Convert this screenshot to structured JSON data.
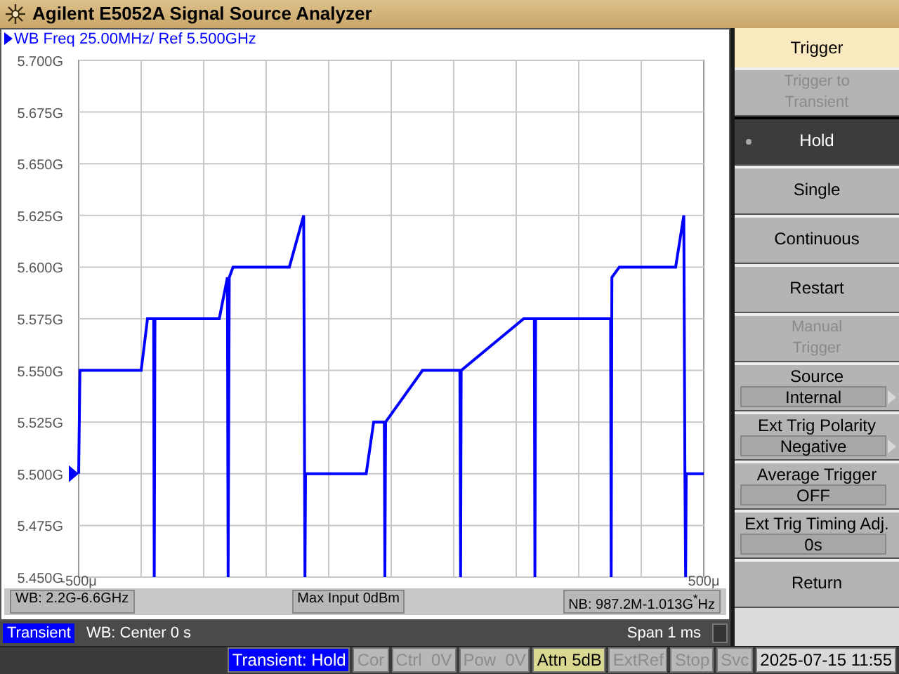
{
  "window": {
    "title": "Agilent E5052A Signal Source Analyzer"
  },
  "trace_title": "WB Freq 25.00MHz/ Ref 5.500GHz",
  "chart_data": {
    "type": "line",
    "grid": true,
    "xlim": [
      -500,
      500
    ],
    "ylim": [
      5.45,
      5.7
    ],
    "xticks": [
      {
        "value": -500,
        "label": "-500μ"
      },
      {
        "value": 500,
        "label": "500μ"
      }
    ],
    "yticks": [
      {
        "value": 5.7,
        "label": "5.700G"
      },
      {
        "value": 5.675,
        "label": "5.675G"
      },
      {
        "value": 5.65,
        "label": "5.650G"
      },
      {
        "value": 5.625,
        "label": "5.625G"
      },
      {
        "value": 5.6,
        "label": "5.600G"
      },
      {
        "value": 5.575,
        "label": "5.575G"
      },
      {
        "value": 5.55,
        "label": "5.550G"
      },
      {
        "value": 5.525,
        "label": "5.525G"
      },
      {
        "value": 5.5,
        "label": "5.500G"
      },
      {
        "value": 5.475,
        "label": "5.475G"
      },
      {
        "value": 5.45,
        "label": "5.450G"
      }
    ],
    "x": [
      -500,
      -498,
      -400,
      -390,
      -380,
      -379,
      -378,
      -275,
      -262,
      -261,
      -259,
      -253,
      -163,
      -140,
      -138,
      -137,
      -40,
      -28,
      -11,
      -10,
      -9,
      50,
      110,
      111,
      112,
      212,
      229,
      230,
      231,
      343,
      351,
      352,
      353,
      365,
      455,
      468,
      470,
      471,
      472,
      500
    ],
    "series": [
      {
        "color": "#0000ff",
        "values": [
          5.5,
          5.55,
          5.55,
          5.575,
          5.575,
          5.45,
          5.575,
          5.575,
          5.595,
          5.45,
          5.595,
          5.6,
          5.6,
          5.625,
          5.45,
          5.5,
          5.5,
          5.525,
          5.525,
          5.45,
          5.525,
          5.55,
          5.55,
          5.45,
          5.55,
          5.575,
          5.575,
          5.45,
          5.575,
          5.575,
          5.575,
          5.45,
          5.595,
          5.6,
          5.6,
          5.625,
          5.5,
          5.45,
          5.5,
          5.5
        ]
      }
    ]
  },
  "info_strip": [
    "WB: 2.2G-6.6GHz",
    "Max Input 0dBm",
    "NB: 987.2M-1.013G$^{*}$Hz"
  ],
  "channel_bar": {
    "mode": "Transient",
    "center": "WB: Center 0 s",
    "span": "Span 1 ms"
  },
  "softkey_menu": {
    "title": "Trigger",
    "keys": [
      {
        "kind": "button",
        "lines": [
          "Trigger to",
          "Transient"
        ],
        "disabled": true,
        "selected": false
      },
      {
        "kind": "button",
        "lines": [
          "Hold"
        ],
        "disabled": false,
        "selected": true
      },
      {
        "kind": "button",
        "lines": [
          "Single"
        ],
        "disabled": false,
        "selected": false
      },
      {
        "kind": "button",
        "lines": [
          "Continuous"
        ],
        "disabled": false,
        "selected": false
      },
      {
        "kind": "button",
        "lines": [
          "Restart"
        ],
        "disabled": false,
        "selected": false
      },
      {
        "kind": "button",
        "lines": [
          "Manual",
          "Trigger"
        ],
        "disabled": true,
        "selected": false
      },
      {
        "kind": "value",
        "lines": [
          "Source"
        ],
        "value": "Internal",
        "submenu": true,
        "disabled": false,
        "selected": false
      },
      {
        "kind": "value",
        "lines": [
          "Ext Trig Polarity"
        ],
        "value": "Negative",
        "submenu": true,
        "disabled": false,
        "selected": false
      },
      {
        "kind": "value",
        "lines": [
          "Average Trigger"
        ],
        "value": "OFF",
        "submenu": false,
        "disabled": false,
        "selected": false
      },
      {
        "kind": "value",
        "lines": [
          "Ext Trig Timing Adj."
        ],
        "value": "0s",
        "submenu": false,
        "disabled": false,
        "selected": false
      },
      {
        "kind": "button",
        "lines": [
          "Return"
        ],
        "disabled": false,
        "selected": false
      }
    ]
  },
  "status_bar": [
    {
      "kind": "highlight",
      "text": "Transient: Hold"
    },
    {
      "kind": "inactive",
      "text": "Cor"
    },
    {
      "kind": "inactive",
      "text": "Ctrl  0V"
    },
    {
      "kind": "inactive",
      "text": "Pow  0V"
    },
    {
      "kind": "warning",
      "text": "Attn 5dB"
    },
    {
      "kind": "inactive",
      "text": "ExtRef"
    },
    {
      "kind": "inactive",
      "text": "Stop"
    },
    {
      "kind": "inactive",
      "text": "Svc"
    },
    {
      "kind": "plain",
      "text": "2025-07-15 11:55"
    }
  ]
}
